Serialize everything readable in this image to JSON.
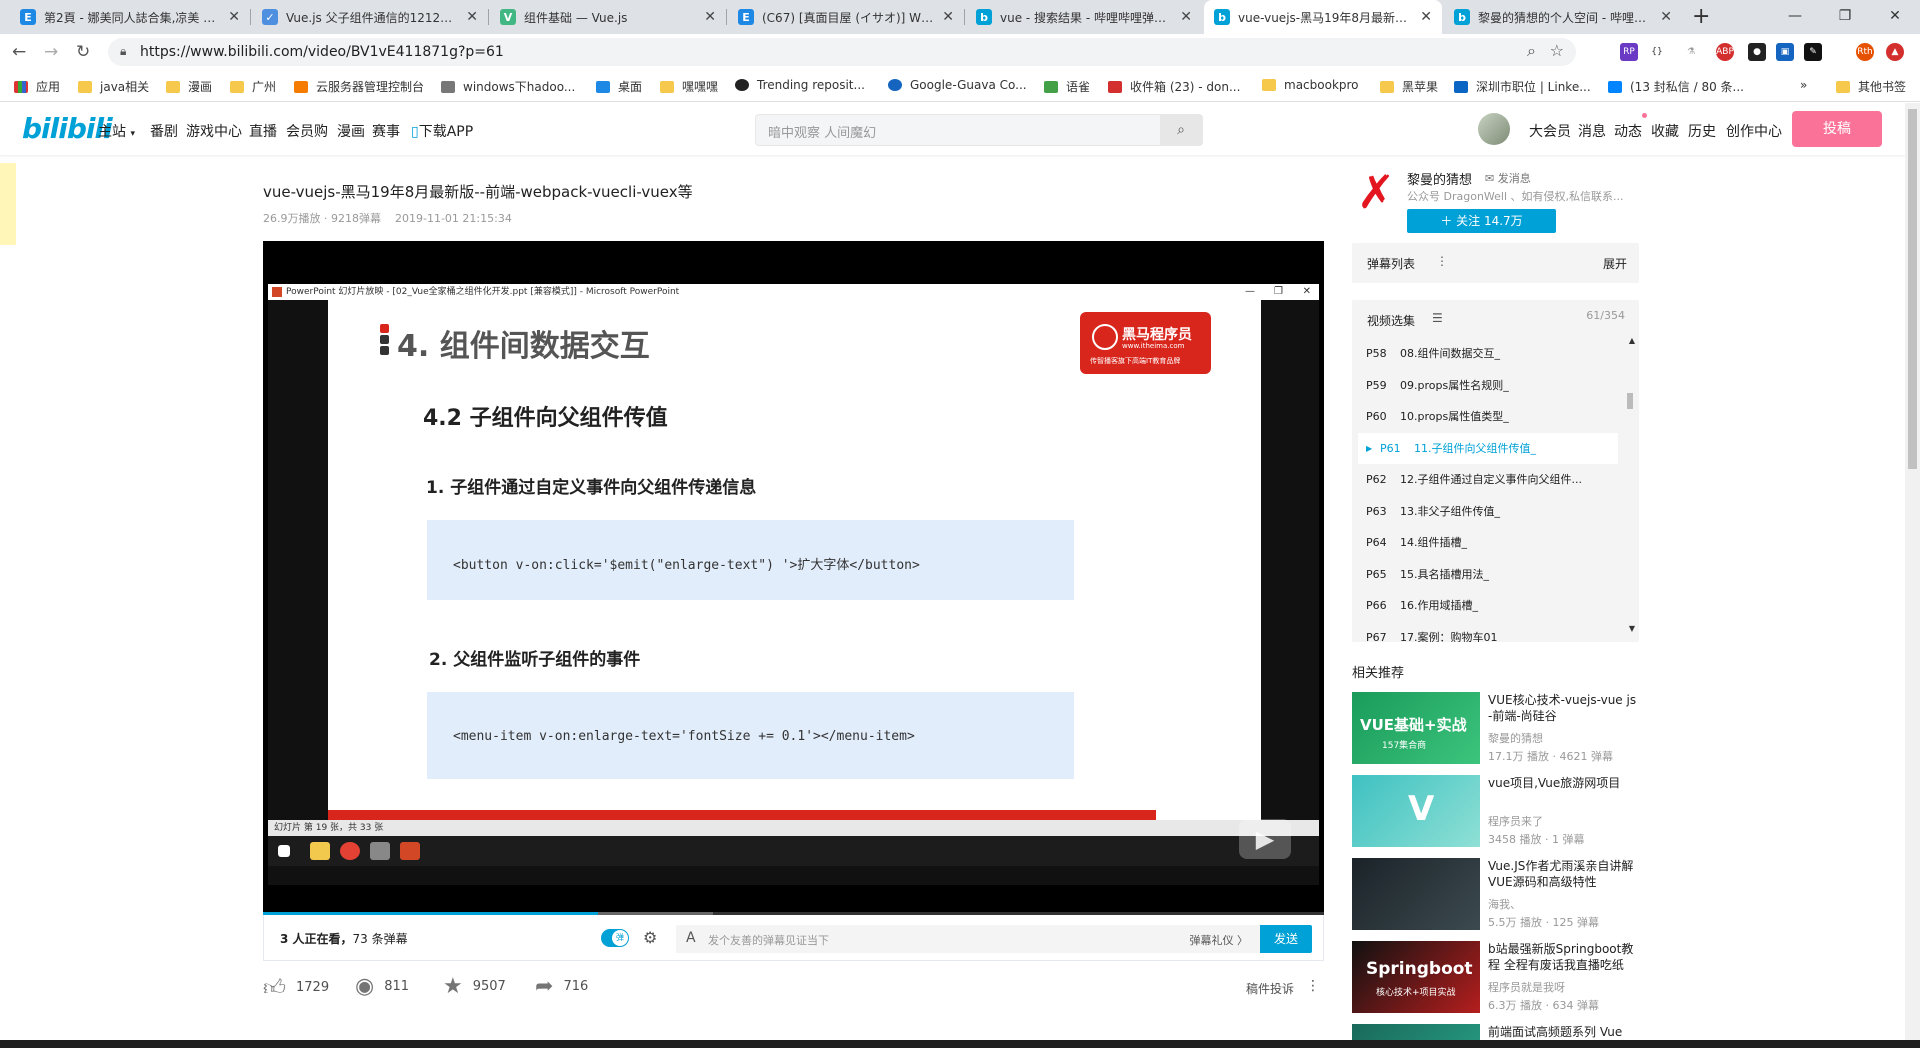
{
  "browser": {
    "tabs": [
      {
        "title": "第2頁 - 娜美同人誌合集,凉美 H...",
        "icon": "E",
        "color": "#1e88e5"
      },
      {
        "title": "Vue.js 父子组件通信的1212种方...",
        "icon": "✓",
        "color": "#4e8fe0"
      },
      {
        "title": "组件基础 — Vue.js",
        "icon": "V",
        "color": "#41b883"
      },
      {
        "title": "(C67) [真面目屋 (イサオ)] Whea...",
        "icon": "E",
        "color": "#1e88e5"
      },
      {
        "title": "vue - 搜索结果 - 哔哩哔哩弹幕视...",
        "icon": "b",
        "color": "#00a1d6"
      },
      {
        "title": "vue-vuejs-黑马19年8月最新版--...",
        "icon": "b",
        "color": "#00a1d6"
      },
      {
        "title": "黎曼的猜想的个人空间 - 哔哩哔哩...",
        "icon": "b",
        "color": "#00a1d6"
      }
    ],
    "url": "https://www.bilibili.com/video/BV1vE411871g?p=61",
    "bookmarks": [
      "应用",
      "java相关",
      "漫画",
      "广州",
      "云服务器管理控制台",
      "windows下hadoo...",
      "桌面",
      "嘿嘿嘿",
      "Trending reposit...",
      "Google-Guava Co...",
      "语雀",
      "收件箱 (23) - don...",
      "macbookpro",
      "黑苹果",
      "深圳市职位 | Linke...",
      "(13 封私信 / 80 条..."
    ],
    "other_bookmarks": "其他书签"
  },
  "site": {
    "logo": "bilibili",
    "nav": [
      "主站",
      "番剧",
      "游戏中心",
      "直播",
      "会员购",
      "漫画",
      "赛事",
      "下载APP"
    ],
    "search_placeholder": "暗中观察 人间魔幻",
    "right_nav": [
      "大会员",
      "消息",
      "动态",
      "收藏",
      "历史",
      "创作中心"
    ],
    "upload": "投稿"
  },
  "video": {
    "title": "vue-vuejs-黑马19年8月最新版--前端-webpack-vuecli-vuex等",
    "plays": "26.9万播放",
    "danmaku_count": "9218弹幕",
    "date": "2019-11-01 21:15:34",
    "progress": 0.316
  },
  "slide": {
    "window_title": "PowerPoint 幻灯片放映 - [02_Vue全家桶之组件化开发.ppt [兼容模式]] - Microsoft PowerPoint",
    "heading": "4. 组件间数据交互",
    "brand": "黑马程序员",
    "brand_url": "www.itheima.com",
    "brand_slogan": "传智播客旗下高端IT教育品牌",
    "subheading": "4.2 子组件向父组件传值",
    "item1": "1.   子组件通过自定义事件向父组件传递信息",
    "code1": "<button v-on:click='$emit(\"enlarge-text\") '>扩大字体</button>",
    "item2": "2.   父组件监听子组件的事件",
    "code2": "<menu-item v-on:enlarge-text='fontSize += 0.1'></menu-item>",
    "status": "幻灯片 第 19 张，共 33 张"
  },
  "danmaku_bar": {
    "watching": "3 人正在看，",
    "danmaku": "73 条弹幕",
    "placeholder": "发个友善的弹幕见证当下",
    "etiquette": "弹幕礼仪 〉",
    "send": "发送"
  },
  "actions": {
    "like": "1729",
    "coin": "811",
    "favorite": "9507",
    "share": "716",
    "report": "稿件投诉"
  },
  "uploader": {
    "name": "黎曼的猜想",
    "message": "发消息",
    "desc": "公众号 DragonWell 、如有侵权,私信联系...",
    "follow": "＋  关注 14.7万"
  },
  "danmaku_list": {
    "label": "弹幕列表",
    "expand": "展开"
  },
  "episodes": {
    "label": "视频选集",
    "count": "61/354",
    "items": [
      {
        "p": "P58",
        "title": "08.组件间数据交互_"
      },
      {
        "p": "P59",
        "title": "09.props属性名规则_"
      },
      {
        "p": "P60",
        "title": "10.props属性值类型_"
      },
      {
        "p": "P61",
        "title": "11.子组件向父组件传值_"
      },
      {
        "p": "P62",
        "title": "12.子组件通过自定义事件向父组件..."
      },
      {
        "p": "P63",
        "title": "13.非父子组件传值_"
      },
      {
        "p": "P64",
        "title": "14.组件插槽_"
      },
      {
        "p": "P65",
        "title": "15.具名插槽用法_"
      },
      {
        "p": "P66",
        "title": "16.作用域插槽_"
      },
      {
        "p": "P67",
        "title": "17.案例：购物车01"
      }
    ]
  },
  "related": {
    "label": "相关推荐",
    "items": [
      {
        "title": "VUE核心技术-vuejs-vue js -前端-尚硅谷",
        "author": "黎曼的猜想",
        "stats": "17.1万 播放 · 4621 弹幕",
        "thumb": "VUE基础+实战",
        "thumb_sub": "157集合商"
      },
      {
        "title": "vue项目,Vue旅游网项目",
        "author": "程序员来了",
        "stats": "3458 播放 · 1 弹幕",
        "thumb": "V",
        "thumb_sub": ""
      },
      {
        "title": "Vue.JS作者尤雨溪亲自讲解VUE源码和高级特性",
        "author": "海我、",
        "stats": "5.5万 播放 · 125 弹幕",
        "thumb": "",
        "thumb_sub": ""
      },
      {
        "title": "b站最强新版Springboot教程 全程有废话我直播吃纸",
        "author": "程序员就是我呀",
        "stats": "6.3万 播放 · 634 弹幕",
        "thumb": "Springboot",
        "thumb_sub": "核心技术+项目实战"
      },
      {
        "title": "前端面试高频题系列 Vue",
        "author": "",
        "stats": "",
        "thumb": "",
        "thumb_sub": ""
      }
    ]
  }
}
